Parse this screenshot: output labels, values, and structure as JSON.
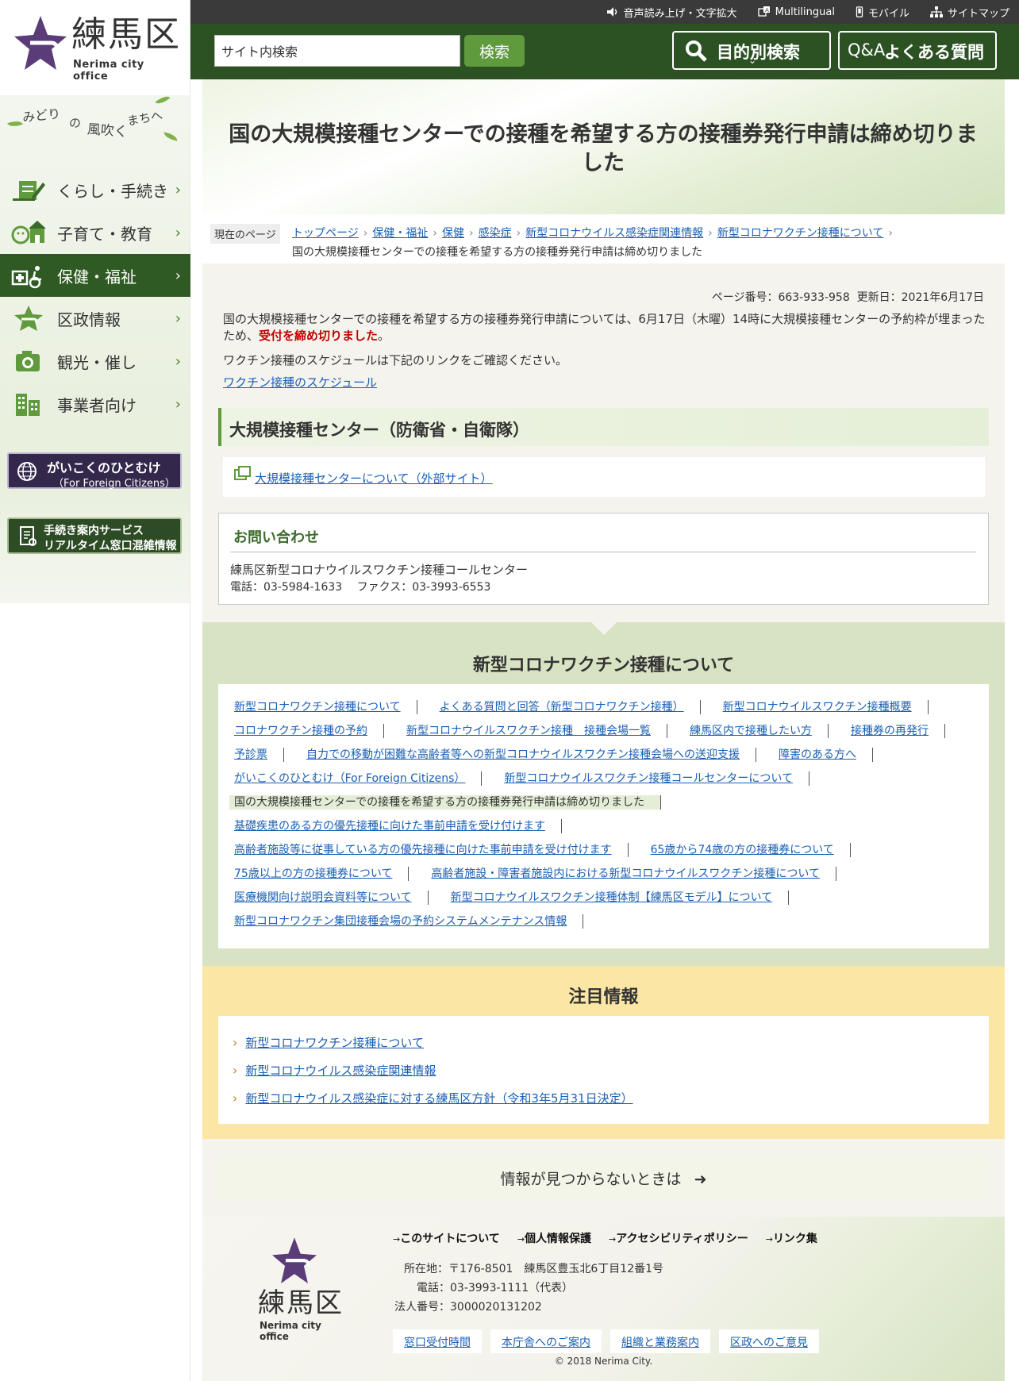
{
  "site": {
    "logo_kanji": "練馬区",
    "logo_en": "Nerima city office",
    "tagline": [
      "みどり",
      "の",
      "風吹く",
      "まちへ"
    ]
  },
  "utility_nav": [
    {
      "label": "音声読み上げ・文字拡大",
      "icon": "speaker-icon"
    },
    {
      "label": "Multilingual",
      "icon": "language-icon"
    },
    {
      "label": "モバイル",
      "icon": "mobile-icon"
    },
    {
      "label": "サイトマップ",
      "icon": "sitemap-icon"
    }
  ],
  "search": {
    "value": "サイト内検索",
    "button": "検索"
  },
  "header_buttons": {
    "purpose": "目的別検索",
    "qa_prefix": "Q&A",
    "qa": "よくある質問"
  },
  "sidebar": {
    "items": [
      {
        "label": "くらし・手続き",
        "icon": "life-procedures-icon"
      },
      {
        "label": "子育て・教育",
        "icon": "childcare-icon"
      },
      {
        "label": "保健・福祉",
        "icon": "health-welfare-icon",
        "active": true
      },
      {
        "label": "区政情報",
        "icon": "ward-admin-icon"
      },
      {
        "label": "観光・催し",
        "icon": "camera-icon"
      },
      {
        "label": "事業者向け",
        "icon": "building-icon"
      }
    ],
    "banner_foreign": {
      "line1": "がいこくのひとむけ",
      "line2": "（For Foreign Citizens）"
    },
    "banner_proc": {
      "line1": "手続き案内サービス",
      "line2": "リアルタイム窓口混雑情報"
    }
  },
  "page": {
    "title": "国の大規模接種センターでの接種を希望する方の接種券発行申請は締め切りました",
    "breadcrumb_label": "現在のページ",
    "breadcrumb": [
      "トップページ",
      "保健・福祉",
      "保健",
      "感染症",
      "新型コロナウイルス感染症関連情報",
      "新型コロナワクチン接種について"
    ],
    "breadcrumb_current": "国の大規模接種センターでの接種を希望する方の接種券発行申請は締め切りました",
    "page_no": "ページ番号：663-933-958",
    "updated": "更新日：2021年6月17日",
    "intro_text": "国の大規模接種センターでの接種を希望する方の接種券発行申請については、6月17日（木曜）14時に大規模接種センターの予約枠が埋まったため、",
    "intro_red": "受付を締め切りました",
    "intro_end": "。",
    "schedule_note": "ワクチン接種のスケジュールは下記のリンクをご確認ください。",
    "schedule_link": "ワクチン接種のスケジュール",
    "section_heading": "大規模接種センター（防衛省・自衛隊）",
    "external_link": "大規模接種センターについて（外部サイト）"
  },
  "contact": {
    "title": "お問い合わせ",
    "name": "練馬区新型コロナウイルスワクチン接種コールセンター",
    "tel": "電話：03-5984-1633　 ファクス：03-3993-6553"
  },
  "related": {
    "title": "新型コロナワクチン接種について",
    "rows": [
      [
        "新型コロナワクチン接種について",
        "よくある質問と回答（新型コロナワクチン接種）",
        "新型コロナウイルスワクチン接種概要"
      ],
      [
        "コロナワクチン接種の予約",
        "新型コロナウイルスワクチン接種　接種会場一覧",
        "練馬区内で接種したい方",
        "接種券の再発行"
      ],
      [
        "予診票",
        "自力での移動が困難な高齢者等への新型コロナウイルスワクチン接種会場への送迎支援",
        "障害のある方へ"
      ],
      [
        "がいこくのひとむけ（For Foreign Citizens）",
        "新型コロナウイルスワクチン接種コールセンターについて"
      ],
      [
        "国の大規模接種センターでの接種を希望する方の接種券発行申請は締め切りました"
      ],
      [
        "基礎疾患のある方の優先接種に向けた事前申請を受け付けます"
      ],
      [
        "高齢者施設等に従事している方の優先接種に向けた事前申請を受け付けます",
        "65歳から74歳の方の接種券について"
      ],
      [
        "75歳以上の方の接種券について",
        "高齢者施設・障害者施設内における新型コロナウイルスワクチン接種について"
      ],
      [
        "医療機関向け説明会資料等について",
        "新型コロナウイルスワクチン接種体制【練馬区モデル】について"
      ],
      [
        "新型コロナワクチン集団接種会場の予約システムメンテナンス情報"
      ]
    ],
    "current": "国の大規模接種センターでの接種を希望する方の接種券発行申請は締め切りました"
  },
  "attention": {
    "title": "注目情報",
    "items": [
      "新型コロナワクチン接種について",
      "新型コロナウイルス感染症関連情報",
      "新型コロナウイルス感染症に対する練馬区方針（令和3年5月31日決定）"
    ]
  },
  "notfound": "情報が見つからないときは",
  "footer": {
    "logo_kanji": "練馬区",
    "logo_en": "Nerima city office",
    "links": [
      "このサイトについて",
      "個人情報保護",
      "アクセシビリティポリシー",
      "リンク集"
    ],
    "address": "所在地：〒176-8501　練馬区豊玉北6丁目12番1号",
    "phone": "電話：03-3993-1111（代表）",
    "corp": "法人番号：3000020131202",
    "buttons": [
      "窓口受付時間",
      "本庁舎へのご案内",
      "組織と業務案内",
      "区政へのご意見"
    ],
    "copyright": "© 2018 Nerima City."
  },
  "colors": {
    "brand_green": "#2c5224",
    "accent_green": "#5f9a3c",
    "brand_purple": "#5a3c78",
    "alert_red": "#c00000",
    "link_blue": "#1a5fb4",
    "attention_yellow": "#fbe6a6"
  }
}
